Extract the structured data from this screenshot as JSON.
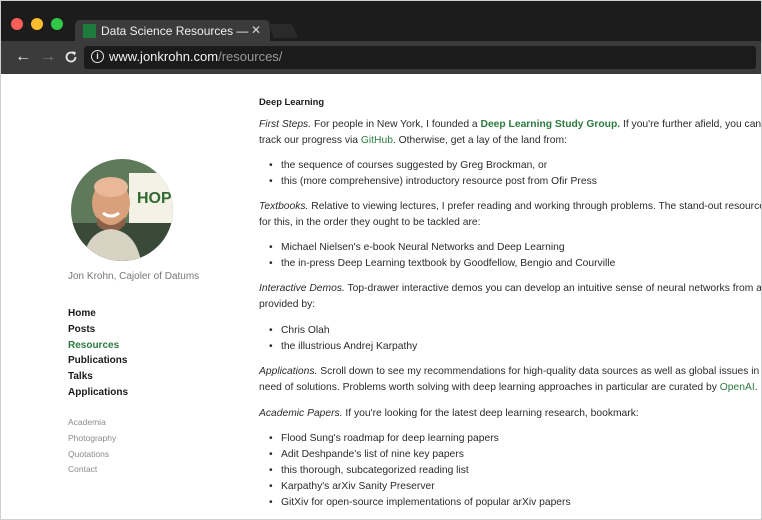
{
  "browser": {
    "tab_title": "Data Science Resources — Jon",
    "tab_close": "✕",
    "url_host": "www.jonkrohn.com",
    "url_path": "/resources/",
    "back": "←",
    "forward": "→",
    "reload": "C",
    "info": "i"
  },
  "sidebar": {
    "author": "Jon Krohn, Cajoler of Datums",
    "nav": [
      "Home",
      "Posts",
      "Resources",
      "Publications",
      "Talks",
      "Applications"
    ],
    "active_nav": "Resources",
    "subnav": [
      "Academia",
      "Photography",
      "Quotations",
      "Contact"
    ],
    "avatar_sign_text": "HOP"
  },
  "content": {
    "heading": "Deep Learning",
    "first_steps": {
      "label": "First Steps.",
      "t1": " For people in New York, I founded a ",
      "link1": "Deep Learning Study Group.",
      "t2": " If you're further afield, you can",
      "t3": "track our progress via ",
      "link2": "GitHub",
      "t4": ". Otherwise, get a lay of the land from:",
      "items": [
        {
          "pre": "the ",
          "link": "sequence of courses",
          "post": " suggested by Greg Brockman, or"
        },
        {
          "pre": "",
          "link": "this",
          "post": " (more comprehensive) introductory resource post from Ofir Press"
        }
      ]
    },
    "textbooks": {
      "label": "Textbooks.",
      "t1": " Relative to viewing lectures, I prefer reading and working through problems. The stand-out resources",
      "t2": "for this, in the order they ought to be tackled are:",
      "items": [
        {
          "pre": "Michael Nielsen's e-book ",
          "link": "Neural Networks and Deep Learning",
          "post": ""
        },
        {
          "pre": "the in-press ",
          "link": "Deep Learning textbook",
          "post": " by Goodfellow, Bengio and Courville"
        }
      ]
    },
    "demos": {
      "label": "Interactive Demos.",
      "t1": " Top-drawer interactive demos you can develop an intuitive sense of neural networks from are",
      "t2": "provided by:",
      "items": [
        {
          "pre": "",
          "link": "Chris Olah",
          "post": ""
        },
        {
          "pre": "the illustrious ",
          "link": "Andrej Karpathy",
          "post": ""
        }
      ]
    },
    "applications": {
      "label": "Applications.",
      "t1": " Scroll down to see my recommendations for high-quality data sources as well as global issues in",
      "t2": "need of solutions. Problems worth solving with deep learning approaches in particular are curated by ",
      "link": "OpenAI",
      "t3": "."
    },
    "papers": {
      "label": "Academic Papers.",
      "t1": " If you're looking for the latest deep learning research, bookmark:",
      "items": [
        {
          "pre": "Flood Sung's ",
          "link": "roadmap",
          "post": " for deep learning papers"
        },
        {
          "pre": "Adit Deshpande's list of ",
          "link": "nine key papers",
          "post": ""
        },
        {
          "pre": "",
          "link": "this",
          "post": " thorough, subcategorized reading list"
        },
        {
          "pre": "Karpathy's ",
          "link": "arXiv Sanity Preserver",
          "post": ""
        },
        {
          "pre": "",
          "link": "GitXiv",
          "post": " for open-source implementations of popular arXiv papers"
        }
      ]
    }
  },
  "colors": {
    "link": "#2d7a3f",
    "tabbar": "#1c1c1c",
    "toolbar": "#3b3b3b",
    "omnibox": "#1b1b1b"
  }
}
